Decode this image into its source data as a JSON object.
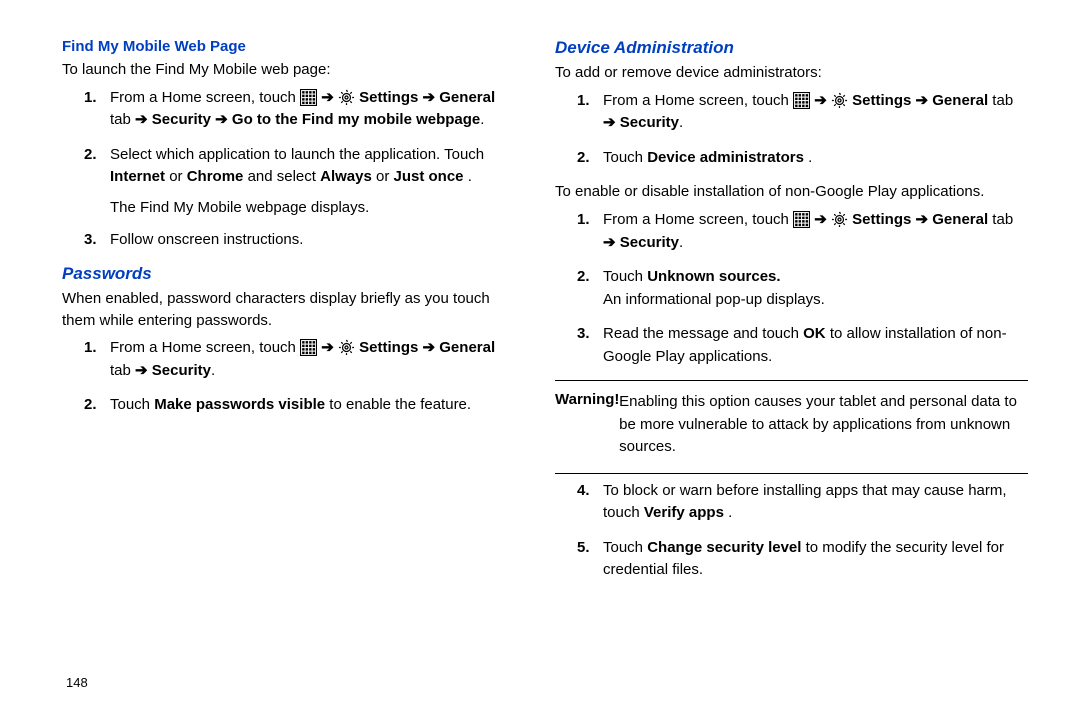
{
  "page_number": "148",
  "left": {
    "section1": {
      "heading": "Find My Mobile Web Page",
      "intro": "To launch the Find My Mobile web page:",
      "step1a": "From a Home screen, touch ",
      "step1b": " Settings ",
      "step1c": "General",
      "step1d": " tab ",
      "step1e": " Security ",
      "step1f": " Go to the Find my mobile webpage",
      "step2a": "Select which application to launch the application. Touch ",
      "step2b": "Internet",
      "step2c": " or ",
      "step2d": "Chrome",
      "step2e": " and select ",
      "step2f": "Always",
      "step2g": " or ",
      "step2h": "Just once",
      "step2i": ".",
      "step2j": "The Find My Mobile webpage displays.",
      "step3": "Follow onscreen instructions."
    },
    "section2": {
      "heading": "Passwords",
      "intro": "When enabled, password characters display briefly as you touch them while entering passwords.",
      "step1a": "From a Home screen, touch ",
      "step1b": " Settings ",
      "step1c": "General",
      "step1d": " tab ",
      "step1e": " Security",
      "step1f": ".",
      "step2a": "Touch ",
      "step2b": "Make passwords visible",
      "step2c": " to enable the feature."
    }
  },
  "right": {
    "heading": "Device Administration",
    "intro1": "To add or remove device administrators:",
    "s1a": "From a Home screen, touch ",
    "s1b": " Settings ",
    "s1c": "General",
    "s1d": " tab ",
    "s1e": " Security",
    "s1f": ".",
    "s2a": "Touch ",
    "s2b": "Device administrators",
    "s2c": ".",
    "intro2": "To enable or disable installation of non-Google Play applications.",
    "t1a": "From a Home screen, touch ",
    "t1b": " Settings ",
    "t1c": "General",
    "t1d": " tab ",
    "t1e": " Security",
    "t1f": ".",
    "t2a": "Touch ",
    "t2b": "Unknown sources.",
    "t2c": "An informational pop-up displays.",
    "t3a": "Read the message and touch ",
    "t3b": "OK",
    "t3c": " to allow installation of non-Google Play applications.",
    "warn_label": "Warning!",
    "warn_text": " Enabling this option causes your tablet and personal data to be more vulnerable to attack by applications from unknown sources.",
    "t4a": "To block or warn before installing apps that may cause harm, touch ",
    "t4b": "Verify apps",
    "t4c": ".",
    "t5a": "Touch ",
    "t5b": "Change security level",
    "t5c": " to modify the security level for credential files."
  }
}
